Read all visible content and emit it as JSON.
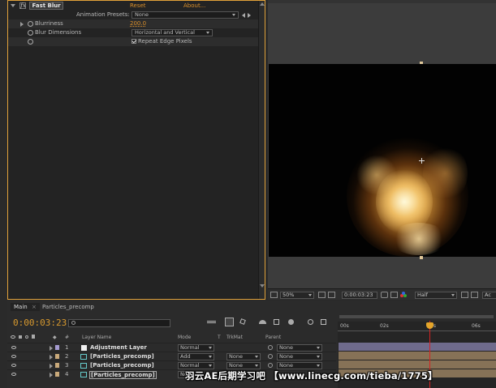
{
  "effect_controls": {
    "effect_name": "Fast Blur",
    "fx_badge": "fx",
    "reset_label": "Reset",
    "about_label": "About...",
    "animation_presets_label": "Animation Presets:",
    "animation_presets_value": "None",
    "blurriness_label": "Blurriness",
    "blurriness_value": "200.0",
    "blur_dimensions_label": "Blur Dimensions",
    "blur_dimensions_value": "Horizontal and Vertical",
    "repeat_edge_label": "Repeat Edge Pixels",
    "repeat_edge_checked": true
  },
  "viewer": {
    "zoom": "50%",
    "timecode": "0:00:03:23",
    "resolution": "Half",
    "partial_label": "Ac"
  },
  "timeline": {
    "tabs": [
      "Main",
      "Particles_precomp"
    ],
    "current_time": "0:00:03:23",
    "columns": {
      "num": "#",
      "layer_name": "Layer Name",
      "mode": "Mode",
      "t": "T",
      "trkmat": "TrkMat",
      "parent": "Parent"
    },
    "ruler": [
      "00s",
      "02s",
      "0s",
      "06s"
    ],
    "layers": [
      {
        "num": "1",
        "name": "Adjustment Layer",
        "mode": "Normal",
        "trkmat": "",
        "parent": "None",
        "label_color": "#a59bd0",
        "track_color": "#6f6b8c"
      },
      {
        "num": "2",
        "name": "[Particles_precomp]",
        "mode": "Add",
        "trkmat": "None",
        "parent": "None",
        "label_color": "#c9a97a",
        "track_color": "#867257"
      },
      {
        "num": "3",
        "name": "[Particles_precomp]",
        "mode": "Normal",
        "trkmat": "None",
        "parent": "None",
        "label_color": "#c9a97a",
        "track_color": "#867257"
      },
      {
        "num": "4",
        "name": "[Particles_precomp]",
        "mode": "No",
        "trkmat": "",
        "parent": "",
        "label_color": "#c9a97a",
        "track_color": "#867257"
      }
    ]
  },
  "watermark": "羽云AE后期学习吧 【www.linecg.com/tieba/1775】"
}
